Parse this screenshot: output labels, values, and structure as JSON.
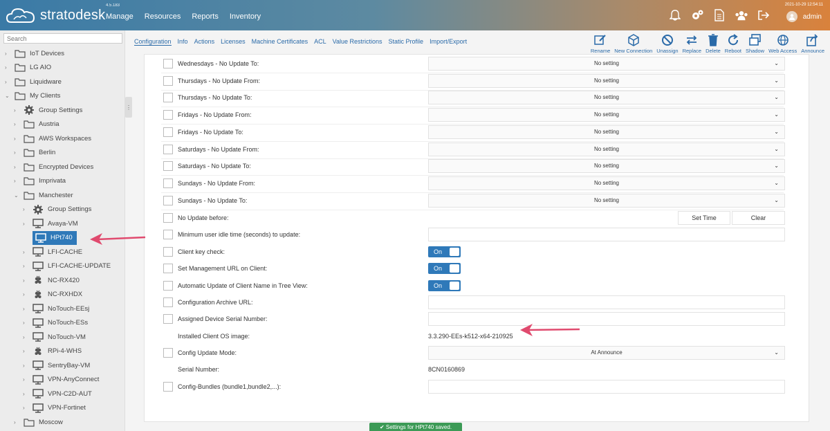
{
  "header": {
    "logo_text": "stratodesk",
    "version": "4.5.183",
    "nav": [
      "Manage",
      "Resources",
      "Reports",
      "Inventory"
    ],
    "datetime": "2021-10-29 12:54:11",
    "user": "admin",
    "icons": [
      "bell-icon",
      "gears-icon",
      "document-icon",
      "users-icon",
      "logout-icon"
    ]
  },
  "sidebar": {
    "search_placeholder": "Search",
    "items": [
      {
        "label": "IoT Devices",
        "icon": "folder"
      },
      {
        "label": "LG AIO",
        "icon": "folder"
      },
      {
        "label": "Liquidware",
        "icon": "folder"
      },
      {
        "label": "My Clients",
        "icon": "folder"
      },
      {
        "label": "Group Settings",
        "icon": "gear"
      },
      {
        "label": "Austria",
        "icon": "folder"
      },
      {
        "label": "AWS Workspaces",
        "icon": "folder"
      },
      {
        "label": "Berlin",
        "icon": "folder"
      },
      {
        "label": "Encrypted Devices",
        "icon": "folder"
      },
      {
        "label": "Imprivata",
        "icon": "folder"
      },
      {
        "label": "Manchester",
        "icon": "folder"
      },
      {
        "label": "Group Settings",
        "icon": "gear"
      },
      {
        "label": "Avaya-VM",
        "icon": "monitor"
      },
      {
        "label": "HPt740",
        "icon": "monitor"
      },
      {
        "label": "LFI-CACHE",
        "icon": "monitor"
      },
      {
        "label": "LFI-CACHE-UPDATE",
        "icon": "monitor"
      },
      {
        "label": "NC-RX420",
        "icon": "raspberry"
      },
      {
        "label": "NC-RXHDX",
        "icon": "raspberry"
      },
      {
        "label": "NoTouch-EEsj",
        "icon": "monitor"
      },
      {
        "label": "NoTouch-ESs",
        "icon": "monitor"
      },
      {
        "label": "NoTouch-VM",
        "icon": "monitor"
      },
      {
        "label": "RPi-4-WHS",
        "icon": "raspberry"
      },
      {
        "label": "SentryBay-VM",
        "icon": "monitor"
      },
      {
        "label": "VPN-AnyConnect",
        "icon": "monitor"
      },
      {
        "label": "VPN-C2D-AUT",
        "icon": "monitor"
      },
      {
        "label": "VPN-Fortinet",
        "icon": "monitor"
      },
      {
        "label": "Moscow",
        "icon": "folder"
      }
    ]
  },
  "tabs": [
    "Configuration",
    "Info",
    "Actions",
    "Licenses",
    "Machine Certificates",
    "ACL",
    "Value Restrictions",
    "Static Profile",
    "Import/Export"
  ],
  "toolbar": [
    "Rename",
    "New Connection",
    "Unassign",
    "Replace",
    "Delete",
    "Reboot",
    "Shadow",
    "Web Access",
    "Announce"
  ],
  "settings": {
    "no_setting": "No setting",
    "rows": {
      "wed_to": "Wednesdays - No Update To:",
      "thu_from": "Thursdays - No Update From:",
      "thu_to": "Thursdays - No Update To:",
      "fri_from": "Fridays - No Update From:",
      "fri_to": "Fridays - No Update To:",
      "sat_from": "Saturdays - No Update From:",
      "sat_to": "Saturdays - No Update To:",
      "sun_from": "Sundays - No Update From:",
      "sun_to": "Sundays - No Update To:",
      "no_update_before": "No Update before:",
      "idle_time": "Minimum user idle time (seconds) to update:",
      "client_key": "Client key check:",
      "mgmt_url": "Set Management URL on Client:",
      "auto_update_name": "Automatic Update of Client Name in Tree View:",
      "archive_url": "Configuration Archive URL:",
      "serial_assigned": "Assigned Device Serial Number:",
      "installed_os": "Installed Client OS image:",
      "config_mode": "Config Update Mode:",
      "serial_number": "Serial Number:",
      "bundles": "Config-Bundles (bundle1,bundle2,...):"
    },
    "set_time": "Set Time",
    "clear": "Clear",
    "toggle_on": "On",
    "installed_os_value": "3.3.290-EEs-k512-x64-210925",
    "config_mode_value": "At Announce",
    "serial_value": "8CN0160869",
    "hidden_top_hint": "Setting"
  },
  "toast": "Settings for HPt740 saved.",
  "colors": {
    "accent": "#2f79b9",
    "arrow": "#e04a6e",
    "toast": "#3c9a56"
  }
}
